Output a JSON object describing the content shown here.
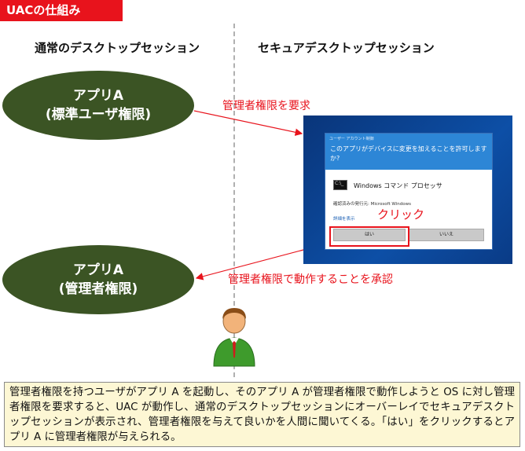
{
  "title": "UACの仕組み",
  "columns": {
    "left": "通常のデスクトップセッション",
    "right": "セキュアデスクトップセッション"
  },
  "app_standard": {
    "line1": "アプリA",
    "line2": "(標準ユーザ権限)"
  },
  "app_admin": {
    "line1": "アプリA",
    "line2": "(管理者権限)"
  },
  "labels": {
    "request": "管理者権限を要求",
    "approve": "管理者権限で動作することを承認",
    "click": "クリック"
  },
  "dialog": {
    "caption": "ユーザー アカウント制御",
    "question": "このアプリがデバイスに変更を加えることを許可しますか?",
    "program": "Windows コマンド プロセッサ",
    "publisher": "確認済みの発行元: Microsoft Windows",
    "details": "詳細を表示",
    "yes": "はい",
    "no": "いいえ"
  },
  "explanation": "管理者権限を持つユーザがアプリ A を起動し、そのアプリ A が管理者権限で動作しようと OS に対し管理者権限を要求すると、UAC が動作し、通常のデスクトップセッションにオーバーレイでセキュアデスクトップセッションが表示され、管理者権限を与えて良いかを人間に聞いてくる。「はい」をクリックするとアプリ A に管理者権限が与えられる。",
  "colors": {
    "accent_red": "#e8131c",
    "ellipse_green": "#3b5424",
    "note_bg": "#fdf7d4"
  }
}
